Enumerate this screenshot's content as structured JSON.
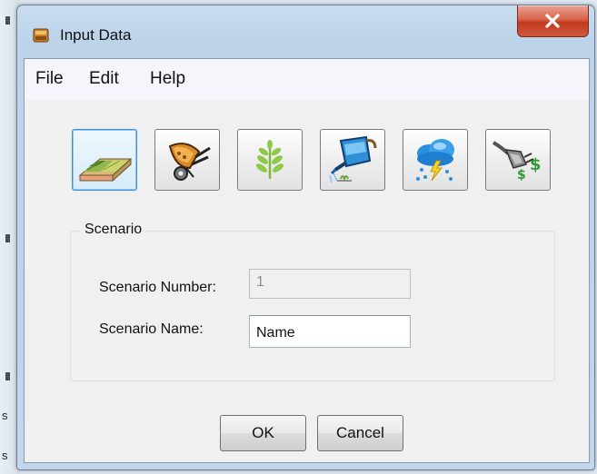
{
  "window": {
    "title": "Input Data",
    "close_glyph": "✕"
  },
  "menu": {
    "items": [
      "File",
      "Edit",
      "Help"
    ]
  },
  "toolbar": {
    "icons": [
      {
        "name": "land-field-icon",
        "selected": true
      },
      {
        "name": "wheelbarrow-icon",
        "selected": false
      },
      {
        "name": "crop-plant-icon",
        "selected": false
      },
      {
        "name": "watering-can-icon",
        "selected": false
      },
      {
        "name": "rain-cloud-icon",
        "selected": false
      },
      {
        "name": "money-plug-icon",
        "selected": false
      }
    ]
  },
  "scenario": {
    "group_title": "Scenario",
    "number_label": "Scenario Number:",
    "number_value": "1",
    "name_label": "Scenario Name:",
    "name_value": "Name"
  },
  "buttons": {
    "ok": "OK",
    "cancel": "Cancel"
  },
  "colors": {
    "title_gradient": "#c9dcef",
    "close_red": "#c13a1f",
    "selected_border": "#3c8fd6",
    "client_bg": "#f0f0f0"
  }
}
